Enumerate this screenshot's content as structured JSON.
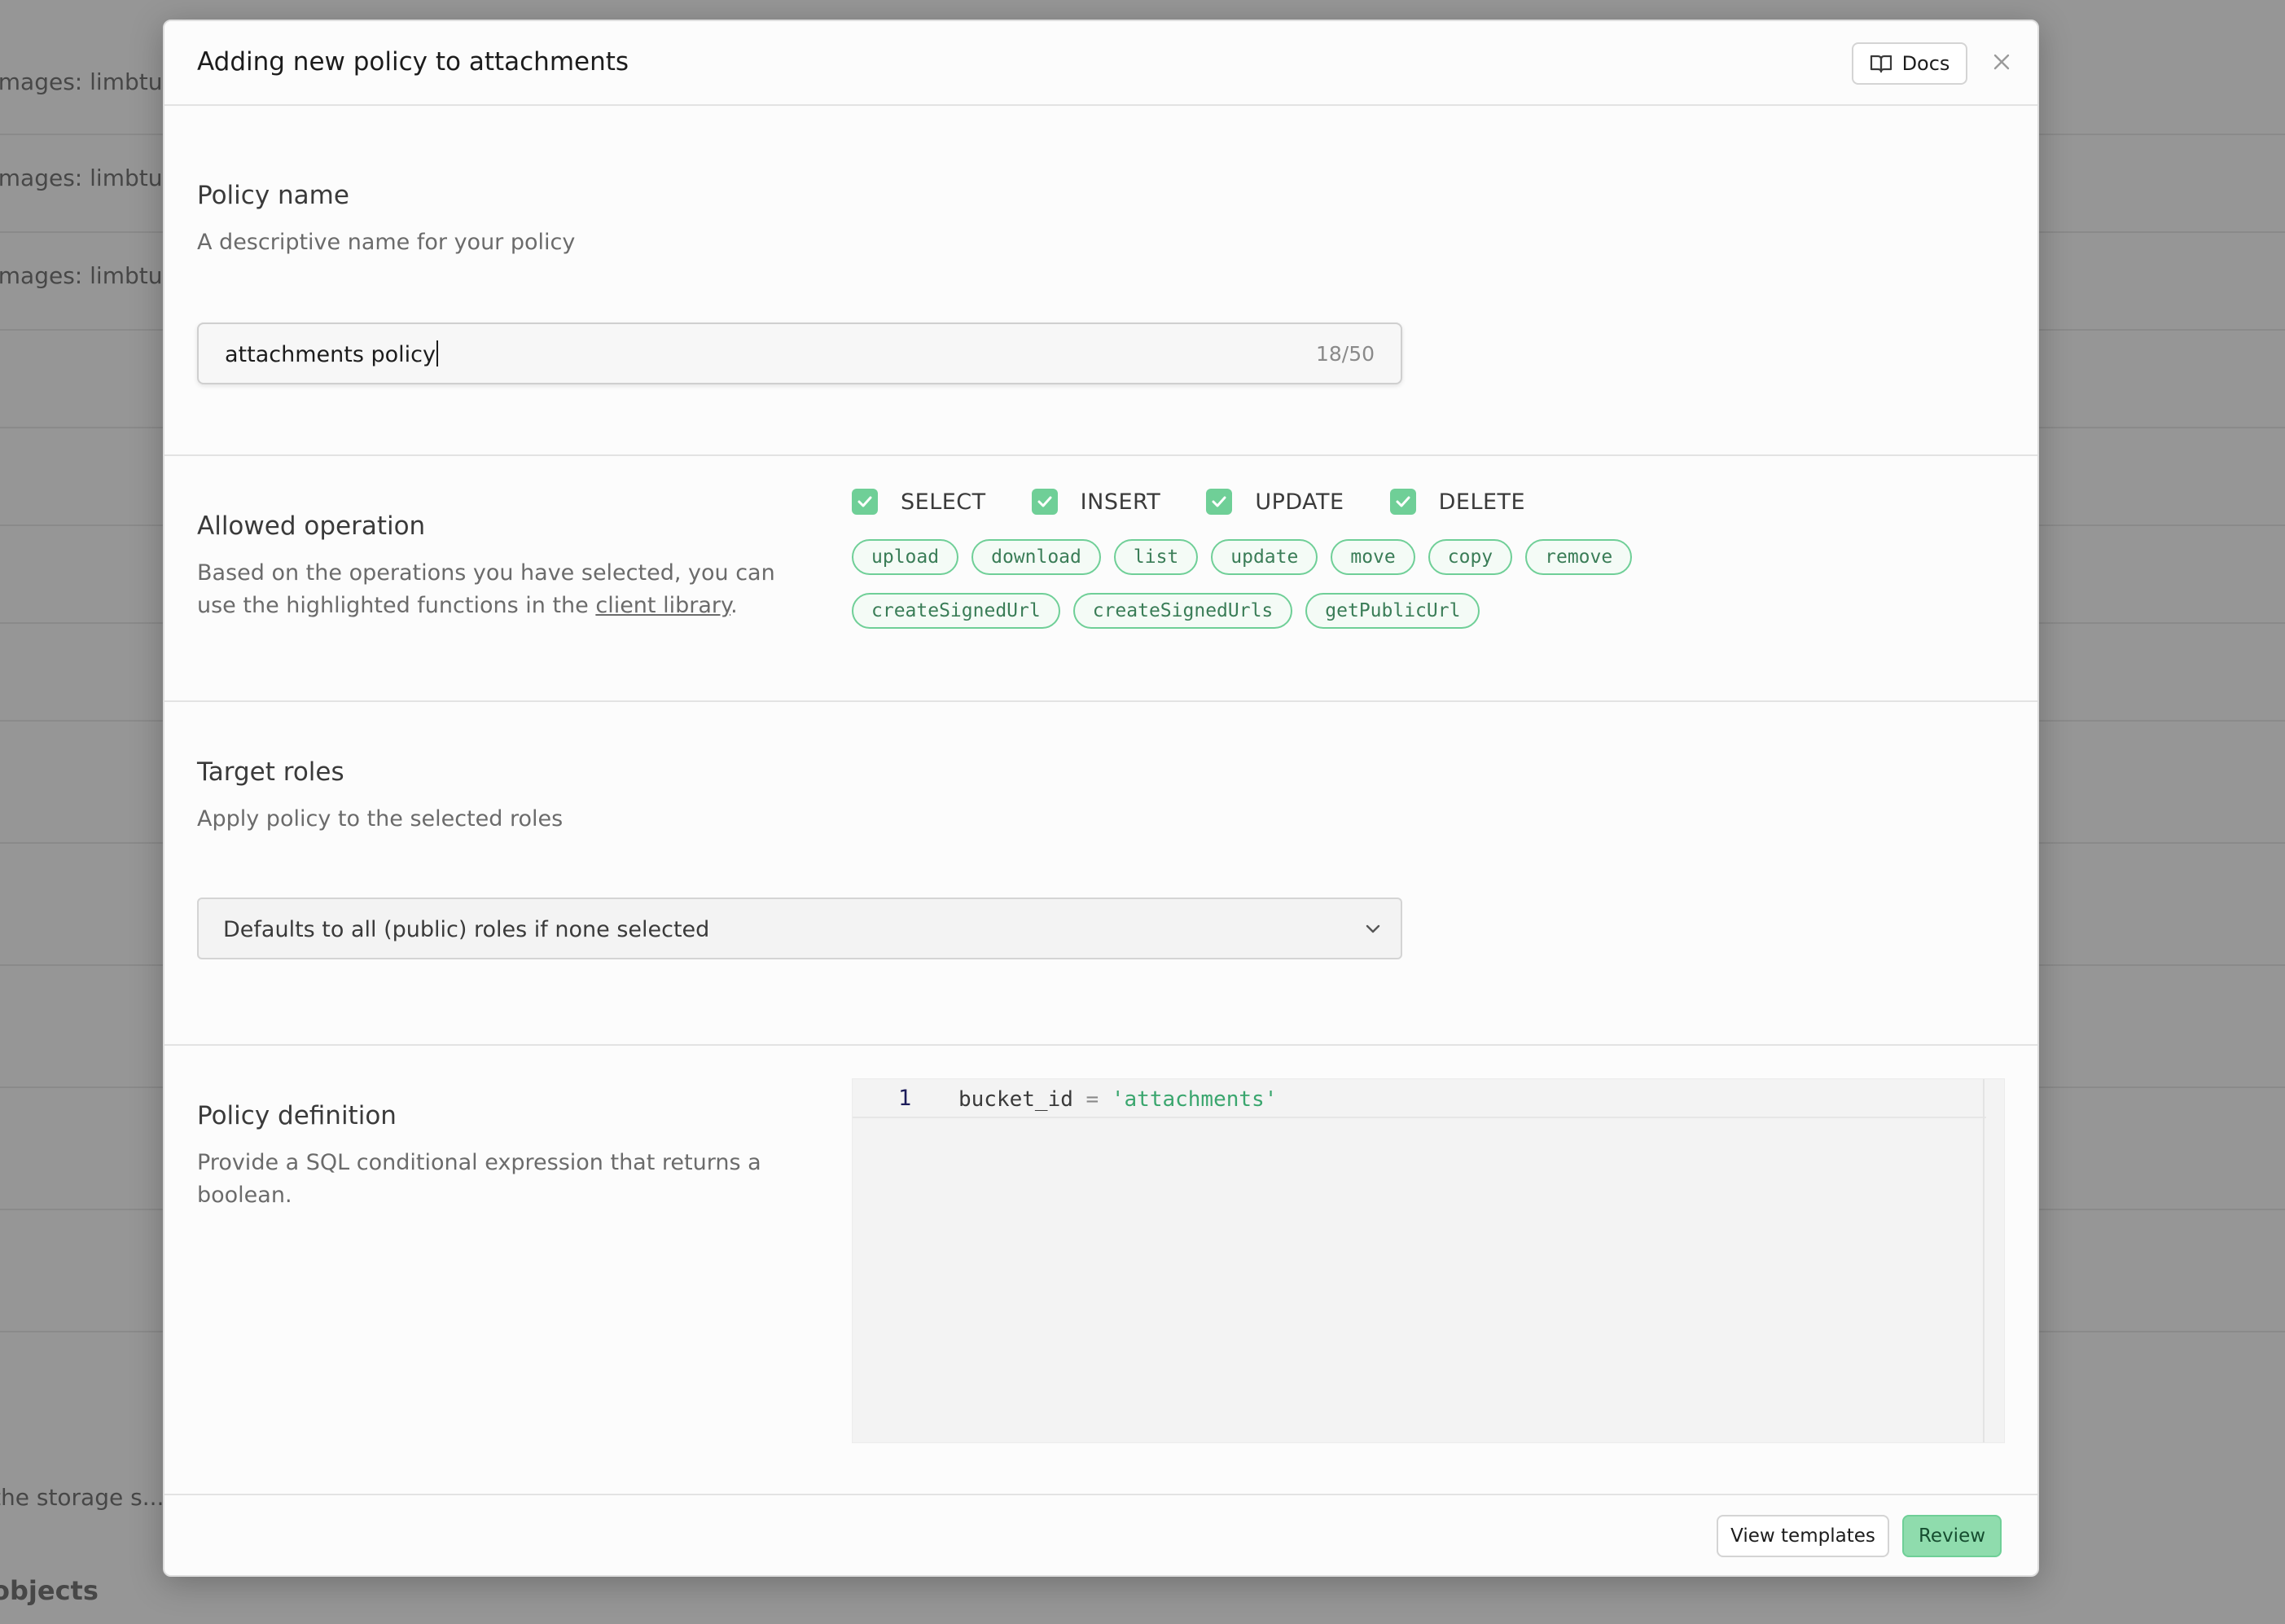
{
  "background": {
    "rows": [
      "images: limbtub...",
      "images: limbtub...",
      "images: limbtub..."
    ],
    "bottom_hint": "the storage s...",
    "bottom_heading": "objects"
  },
  "modal": {
    "title": "Adding new policy to attachments",
    "docs_label": "Docs"
  },
  "policy_name": {
    "title": "Policy name",
    "description": "A descriptive name for your policy",
    "value": "attachments policy",
    "counter": "18/50"
  },
  "allowed_operation": {
    "title": "Allowed operation",
    "description_pre": "Based on the operations you have selected, you can use the highlighted functions in the ",
    "link": "client library",
    "description_post": ".",
    "operations": [
      {
        "label": "SELECT",
        "checked": true
      },
      {
        "label": "INSERT",
        "checked": true
      },
      {
        "label": "UPDATE",
        "checked": true
      },
      {
        "label": "DELETE",
        "checked": true
      }
    ],
    "functions_row1": [
      "upload",
      "download",
      "list",
      "update",
      "move",
      "copy",
      "remove"
    ],
    "functions_row2": [
      "createSignedUrl",
      "createSignedUrls",
      "getPublicUrl"
    ]
  },
  "target_roles": {
    "title": "Target roles",
    "description": "Apply policy to the selected roles",
    "select_value": "Defaults to all (public) roles if none selected"
  },
  "policy_definition": {
    "title": "Policy definition",
    "description": "Provide a SQL conditional expression that returns a boolean.",
    "line_number": "1",
    "code_ident": "bucket_id",
    "code_op": "=",
    "code_string": "'attachments'"
  },
  "footer": {
    "view_templates": "View templates",
    "review": "Review"
  },
  "colors": {
    "accent": "#6fcf97",
    "review_bg": "#8fdcad",
    "tag_text": "#3a7d57"
  }
}
